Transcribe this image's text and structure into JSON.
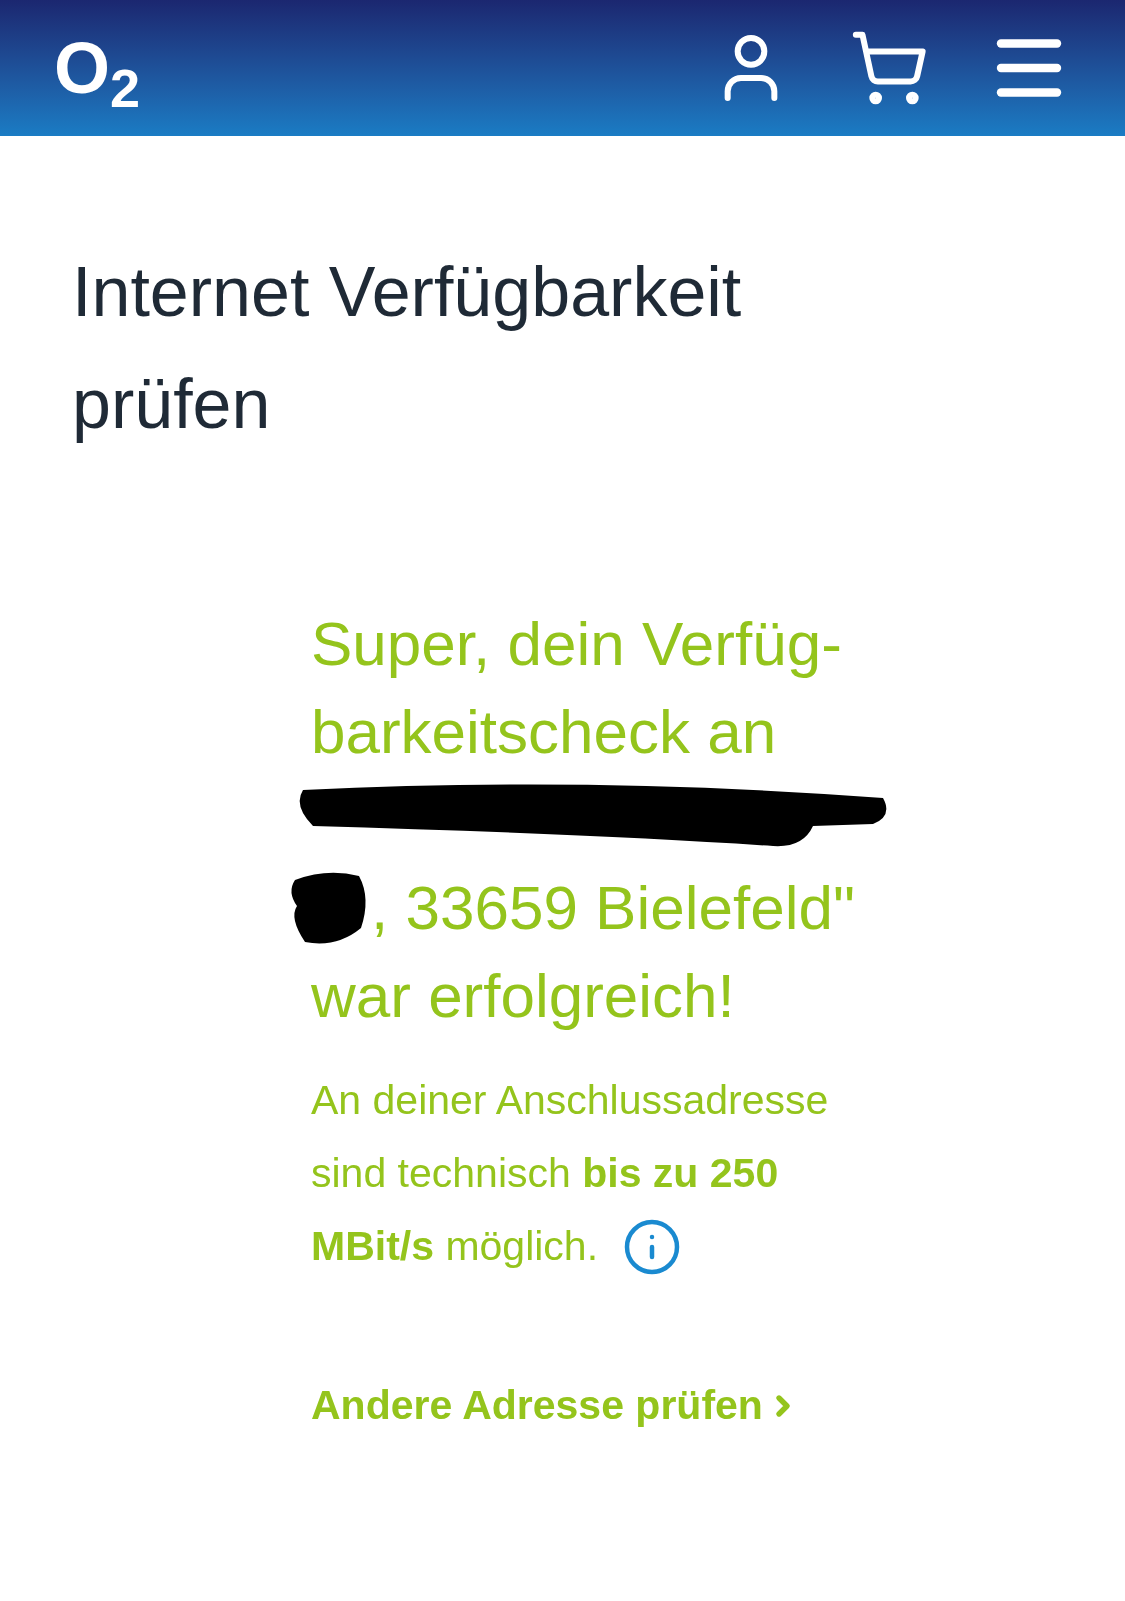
{
  "header": {
    "logo": "O$_{2}$"
  },
  "page_title": "Internet Verfügbarkeit prüfen",
  "result": {
    "headline_lines": [
      "Super, dein Verfüg-",
      "barkeitscheck an"
    ],
    "headline_after_redaction": ", 33659 Bielefeld\"",
    "headline_end": "war erfolgreich!",
    "body_lines": [
      "An deiner Anschlussadresse",
      "sind technisch **bis zu 250**",
      "**MBit/s** möglich."
    ],
    "link": "Andere Adresse prüfen"
  }
}
